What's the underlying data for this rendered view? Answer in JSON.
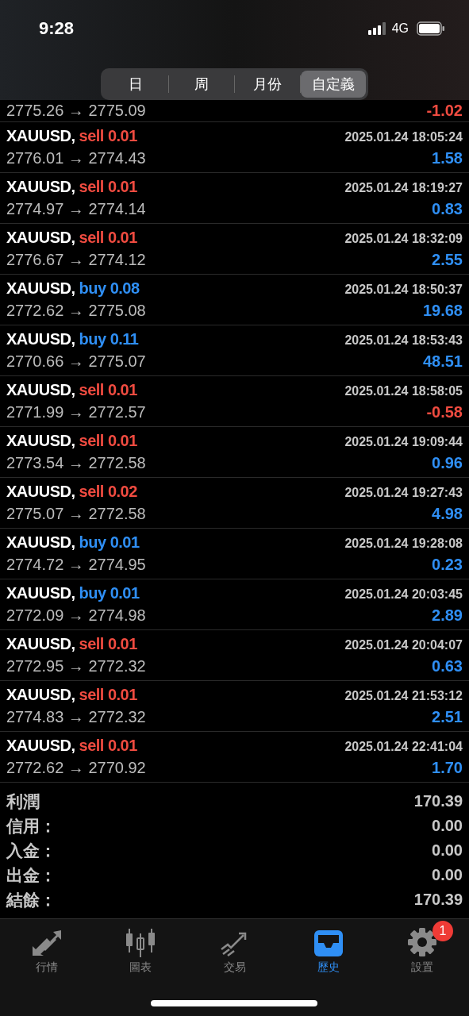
{
  "status_bar": {
    "time": "9:28",
    "network": "4G"
  },
  "period_tabs": [
    {
      "label": "日",
      "selected": false
    },
    {
      "label": "周",
      "selected": false
    },
    {
      "label": "月份",
      "selected": false
    },
    {
      "label": "自定義",
      "selected": true
    }
  ],
  "partial_row": {
    "prices": "2775.26 → 2775.09",
    "profit": "-1.02",
    "loss": true
  },
  "deals": [
    {
      "symbol": "XAUUSD,",
      "trade": "sell 0.01",
      "kind": "sell",
      "time": "2025.01.24 18:05:24",
      "prices": "2776.01 → 2774.43",
      "profit": "1.58",
      "loss": false
    },
    {
      "symbol": "XAUUSD,",
      "trade": "sell 0.01",
      "kind": "sell",
      "time": "2025.01.24 18:19:27",
      "prices": "2774.97 → 2774.14",
      "profit": "0.83",
      "loss": false
    },
    {
      "symbol": "XAUUSD,",
      "trade": "sell 0.01",
      "kind": "sell",
      "time": "2025.01.24 18:32:09",
      "prices": "2776.67 → 2774.12",
      "profit": "2.55",
      "loss": false
    },
    {
      "symbol": "XAUUSD,",
      "trade": "buy 0.08",
      "kind": "buy",
      "time": "2025.01.24 18:50:37",
      "prices": "2772.62 → 2775.08",
      "profit": "19.68",
      "loss": false
    },
    {
      "symbol": "XAUUSD,",
      "trade": "buy 0.11",
      "kind": "buy",
      "time": "2025.01.24 18:53:43",
      "prices": "2770.66 → 2775.07",
      "profit": "48.51",
      "loss": false
    },
    {
      "symbol": "XAUUSD,",
      "trade": "sell 0.01",
      "kind": "sell",
      "time": "2025.01.24 18:58:05",
      "prices": "2771.99 → 2772.57",
      "profit": "-0.58",
      "loss": true
    },
    {
      "symbol": "XAUUSD,",
      "trade": "sell 0.01",
      "kind": "sell",
      "time": "2025.01.24 19:09:44",
      "prices": "2773.54 → 2772.58",
      "profit": "0.96",
      "loss": false
    },
    {
      "symbol": "XAUUSD,",
      "trade": "sell 0.02",
      "kind": "sell",
      "time": "2025.01.24 19:27:43",
      "prices": "2775.07 → 2772.58",
      "profit": "4.98",
      "loss": false
    },
    {
      "symbol": "XAUUSD,",
      "trade": "buy 0.01",
      "kind": "buy",
      "time": "2025.01.24 19:28:08",
      "prices": "2774.72 → 2774.95",
      "profit": "0.23",
      "loss": false
    },
    {
      "symbol": "XAUUSD,",
      "trade": "buy 0.01",
      "kind": "buy",
      "time": "2025.01.24 20:03:45",
      "prices": "2772.09 → 2774.98",
      "profit": "2.89",
      "loss": false
    },
    {
      "symbol": "XAUUSD,",
      "trade": "sell 0.01",
      "kind": "sell",
      "time": "2025.01.24 20:04:07",
      "prices": "2772.95 → 2772.32",
      "profit": "0.63",
      "loss": false
    },
    {
      "symbol": "XAUUSD,",
      "trade": "sell 0.01",
      "kind": "sell",
      "time": "2025.01.24 21:53:12",
      "prices": "2774.83 → 2772.32",
      "profit": "2.51",
      "loss": false
    },
    {
      "symbol": "XAUUSD,",
      "trade": "sell 0.01",
      "kind": "sell",
      "time": "2025.01.24 22:41:04",
      "prices": "2772.62 → 2770.92",
      "profit": "1.70",
      "loss": false
    }
  ],
  "summary": [
    {
      "label": "利潤",
      "value": "170.39"
    },
    {
      "label": "信用：",
      "value": "0.00"
    },
    {
      "label": "入金：",
      "value": "0.00"
    },
    {
      "label": "出金：",
      "value": "0.00"
    },
    {
      "label": "結餘：",
      "value": "170.39"
    }
  ],
  "tab_bar": [
    {
      "label": "行情",
      "kind": "quotes",
      "selected": false
    },
    {
      "label": "圖表",
      "kind": "chart",
      "selected": false
    },
    {
      "label": "交易",
      "kind": "trade",
      "selected": false
    },
    {
      "label": "歷史",
      "kind": "history",
      "selected": true
    },
    {
      "label": "設置",
      "kind": "settings",
      "selected": false,
      "badge": "1"
    }
  ]
}
